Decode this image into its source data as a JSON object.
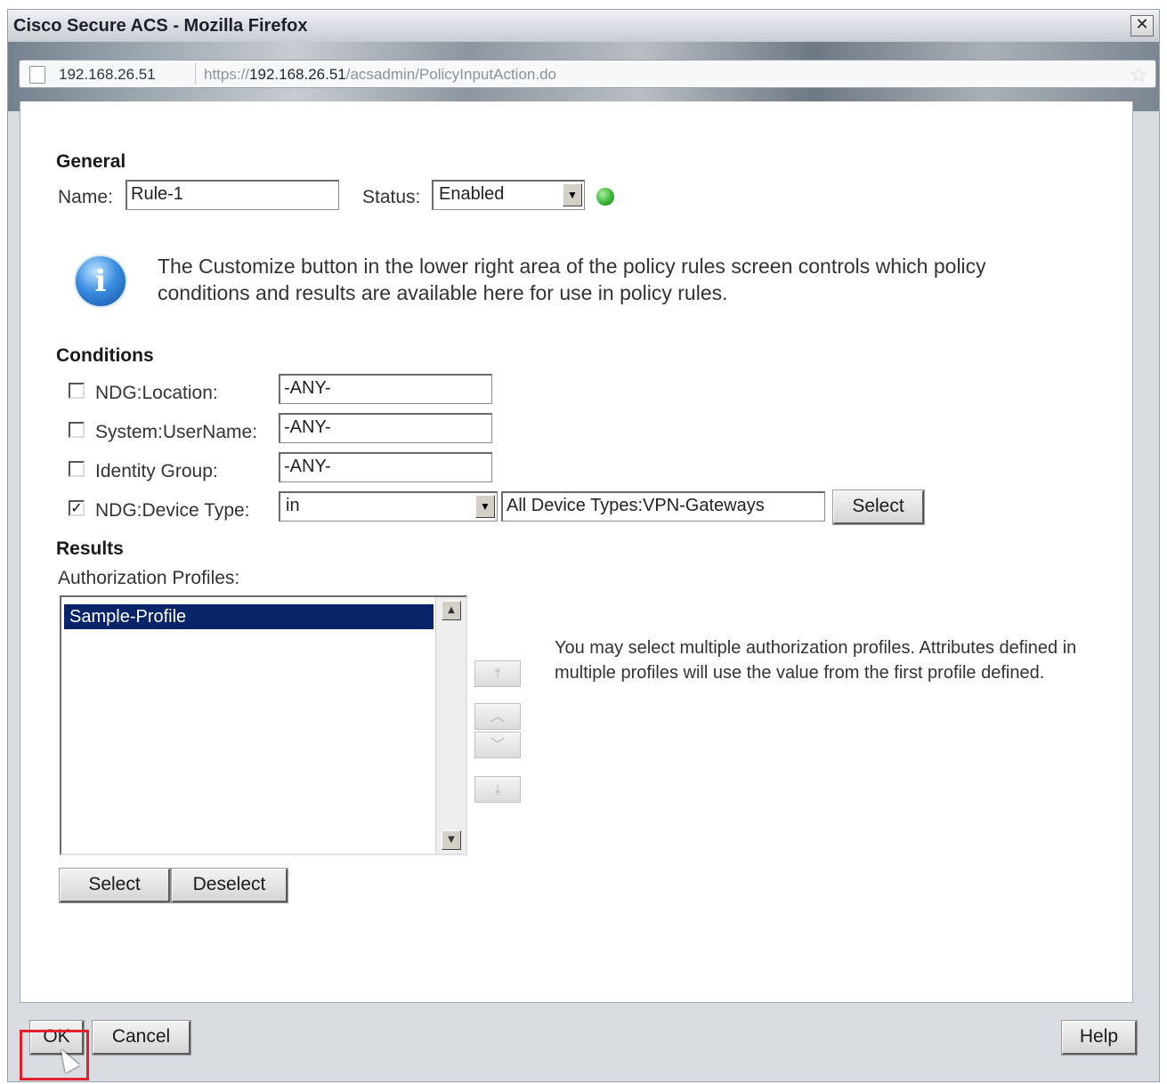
{
  "window": {
    "title": "Cisco Secure ACS - Mozilla Firefox",
    "close_glyph": "✕"
  },
  "urlbar": {
    "site_identity": "192.168.26.51",
    "url_scheme": "https://",
    "url_host": "192.168.26.51",
    "url_path": "/acsadmin/PolicyInputAction.do"
  },
  "general": {
    "heading": "General",
    "name_label": "Name:",
    "name_value": "Rule-1",
    "status_label": "Status:",
    "status_value": "Enabled",
    "status_color": "#33b02e"
  },
  "info": {
    "icon": "info-icon",
    "text": "The Customize button in the lower right area of the policy rules screen controls which policy conditions and results are available here for use in policy rules."
  },
  "conditions": {
    "heading": "Conditions",
    "items": [
      {
        "label": "NDG:Location:",
        "checked": false,
        "value": "-ANY-"
      },
      {
        "label": "System:UserName:",
        "checked": false,
        "value": "-ANY-"
      },
      {
        "label": "Identity Group:",
        "checked": false,
        "value": "-ANY-"
      },
      {
        "label": "NDG:Device Type:",
        "checked": true,
        "operator": "in",
        "value": "All Device Types:VPN-Gateways",
        "button": "Select"
      }
    ]
  },
  "results": {
    "heading": "Results",
    "profiles_label": "Authorization Profiles:",
    "profiles": [
      "Sample-Profile"
    ],
    "selected_profile": "Sample-Profile",
    "note": "You may select multiple authorization profiles. Attributes defined in multiple profiles will use the value from the first profile defined.",
    "select_button": "Select",
    "deselect_button": "Deselect"
  },
  "footer": {
    "ok": "OK",
    "cancel": "Cancel",
    "help": "Help",
    "highlight_color": "#e0202a"
  }
}
